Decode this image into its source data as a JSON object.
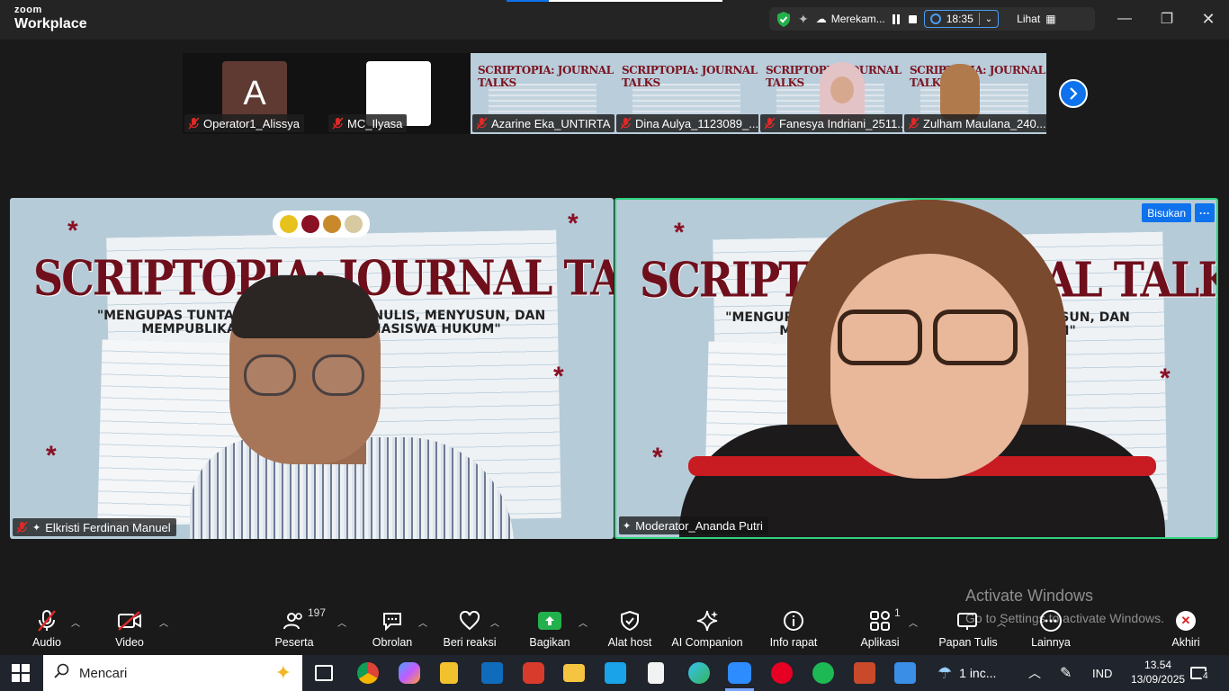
{
  "app": {
    "brand_small": "zoom",
    "brand_big": "Workplace"
  },
  "status": {
    "recording_label": "Merekam...",
    "timer": "18:35",
    "view_label": "Lihat"
  },
  "thumbnails": [
    {
      "name": "Operator1_Alissya",
      "kind": "avatar",
      "avatar_letter": "A"
    },
    {
      "name": "MC_Ilyasa",
      "kind": "blank"
    },
    {
      "name": "Azarine Eka_UNTIRTA",
      "kind": "slide"
    },
    {
      "name": "Dina Aulya_1123089_...",
      "kind": "slide"
    },
    {
      "name": "Fanesya Indriani_2511...",
      "kind": "slide-face"
    },
    {
      "name": "Zulham Maulana_240...",
      "kind": "slide-dog"
    }
  ],
  "thumb_slide_title": "SCRIPTOPIA: JOURNAL TALKS",
  "tiles": {
    "left": {
      "name": "Elkristi Ferdinan Manuel",
      "slide_title": "SCRIPTOPIA: JOURNAL TALKS",
      "slide_sub_1": "\"MENGUPAS TUNTAS DUNI          AN MENULIS, MENYUSUN, DAN",
      "slide_sub_2": "MEMPUBLIKASIK                       AHASISWA HUKUM\""
    },
    "right": {
      "name": "Moderator_Ananda Putri",
      "badge": "Bisukan",
      "more": "···",
      "slide_title": "SCRIPTO                AL TALKS",
      "slide_sub_1": "\"MENGUPAS TUNTAS D                     LIS, MENYUSUN, DAN",
      "slide_sub_2": "MEMPUBLIKASI                          A HUKUM\""
    }
  },
  "toolbar": {
    "audio": "Audio",
    "video": "Video",
    "participants": "Peserta",
    "participants_count": "197",
    "chat": "Obrolan",
    "react": "Beri reaksi",
    "share": "Bagikan",
    "host_tools": "Alat host",
    "ai": "AI Companion",
    "info": "Info rapat",
    "apps": "Aplikasi",
    "apps_count": "1",
    "whiteboard": "Papan Tulis",
    "more": "Lainnya",
    "end": "Akhiri"
  },
  "watermark": {
    "line1": "Activate Windows",
    "line2": "Go to Settings to activate Windows."
  },
  "taskbar": {
    "search_placeholder": "Mencari",
    "weather": "1 inc...",
    "lang": "IND",
    "time": "13.54",
    "date": "13/09/2025",
    "notifications": "4"
  },
  "colors": {
    "accent": "#0e72ed",
    "active_speaker": "#2fd27e",
    "muted": "#e02828",
    "share": "#22b14c"
  }
}
